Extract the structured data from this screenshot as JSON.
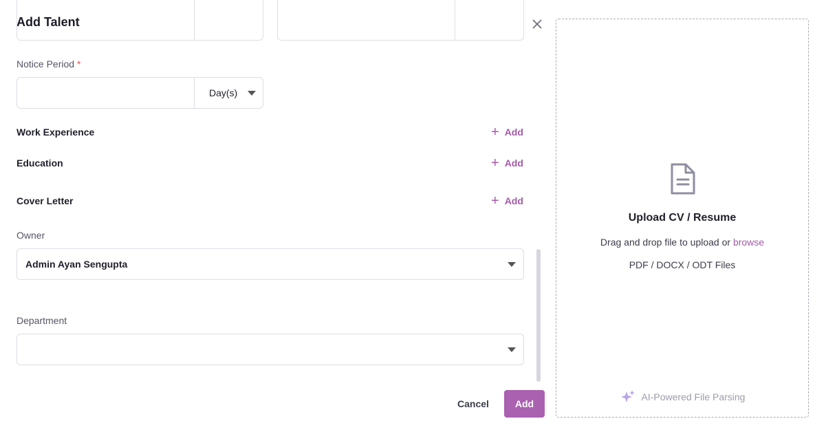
{
  "dialog": {
    "title": "Add Talent",
    "close_icon": "close-icon"
  },
  "notice_period": {
    "label": "Notice Period",
    "required_mark": "*",
    "value": "",
    "unit": "Day(s)"
  },
  "sections": {
    "work_experience": {
      "title": "Work Experience",
      "add_label": "Add"
    },
    "education": {
      "title": "Education",
      "add_label": "Add"
    },
    "cover_letter": {
      "title": "Cover Letter",
      "add_label": "Add"
    }
  },
  "owner": {
    "label": "Owner",
    "value": "Admin Ayan Sengupta"
  },
  "department": {
    "label": "Department",
    "value": ""
  },
  "footer": {
    "cancel_label": "Cancel",
    "add_label": "Add"
  },
  "upload": {
    "title": "Upload CV / Resume",
    "subtitle_prefix": "Drag and drop file to upload or",
    "browse_label": "browse",
    "file_types": "PDF / DOCX / ODT Files",
    "ai_label": "AI-Powered File Parsing"
  },
  "colors": {
    "accent": "#a961b0",
    "link": "#a55aa8",
    "required": "#d9534f"
  }
}
